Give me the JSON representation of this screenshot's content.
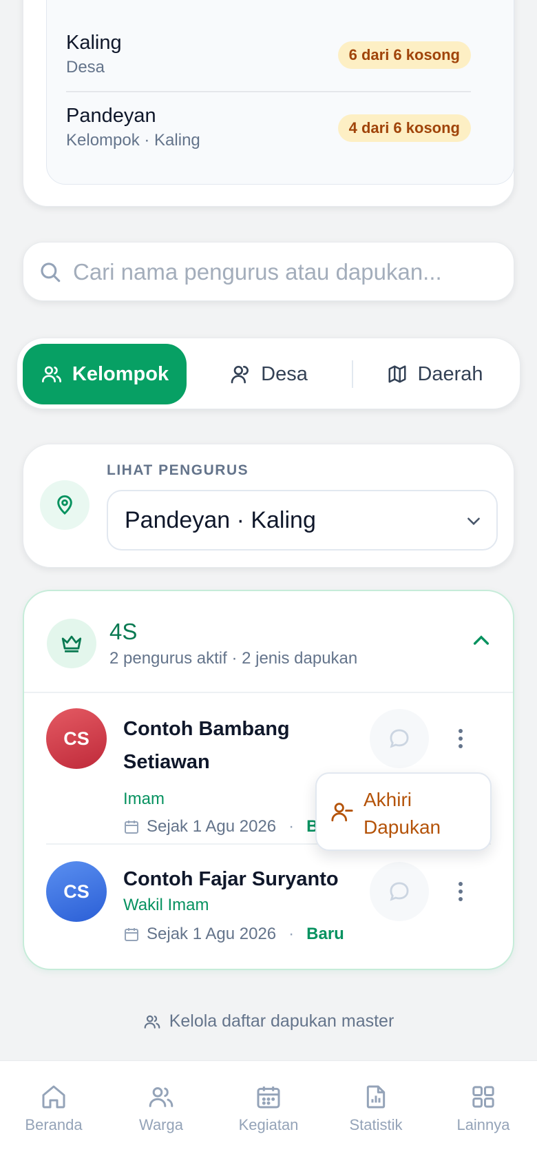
{
  "vacancies": [
    {
      "name": "Kaling",
      "sub": "Desa",
      "badge": "6 dari 6 kosong"
    },
    {
      "name": "Pandeyan",
      "sub": "Kelompok · Kaling",
      "badge": "4 dari 6 kosong"
    }
  ],
  "search": {
    "placeholder": "Cari nama pengurus atau dapukan..."
  },
  "tabs": [
    {
      "label": "Kelompok",
      "active": true
    },
    {
      "label": "Desa",
      "active": false
    },
    {
      "label": "Daerah",
      "active": false
    }
  ],
  "selector": {
    "label": "LIHAT PENGURUS",
    "value": "Pandeyan · Kaling"
  },
  "group": {
    "title": "4S",
    "subtitle": "2 pengurus aktif · 2 jenis dapukan",
    "members": [
      {
        "initials": "CS",
        "name_line1": "Contoh Bambang",
        "name_line2": "Setiawan",
        "role": "Imam",
        "since": "Sejak 1 Agu 2026",
        "status": "Baru"
      },
      {
        "initials": "CS",
        "name": "Contoh Fajar Suryanto",
        "role": "Wakil Imam",
        "since": "Sejak 1 Agu 2026",
        "status": "Baru"
      }
    ]
  },
  "popup": {
    "label": "Akhiri Dapukan"
  },
  "manage_link": "Kelola daftar dapukan master",
  "nav": [
    {
      "label": "Beranda",
      "icon": "home-icon"
    },
    {
      "label": "Warga",
      "icon": "users-icon"
    },
    {
      "label": "Kegiatan",
      "icon": "calendar-icon"
    },
    {
      "label": "Statistik",
      "icon": "chart-file-icon"
    },
    {
      "label": "Lainnya",
      "icon": "grid-icon"
    }
  ],
  "colors": {
    "primary": "#07a064",
    "badge_bg": "#fdefc4",
    "badge_text": "#a0440a",
    "danger_action": "#b45309"
  }
}
